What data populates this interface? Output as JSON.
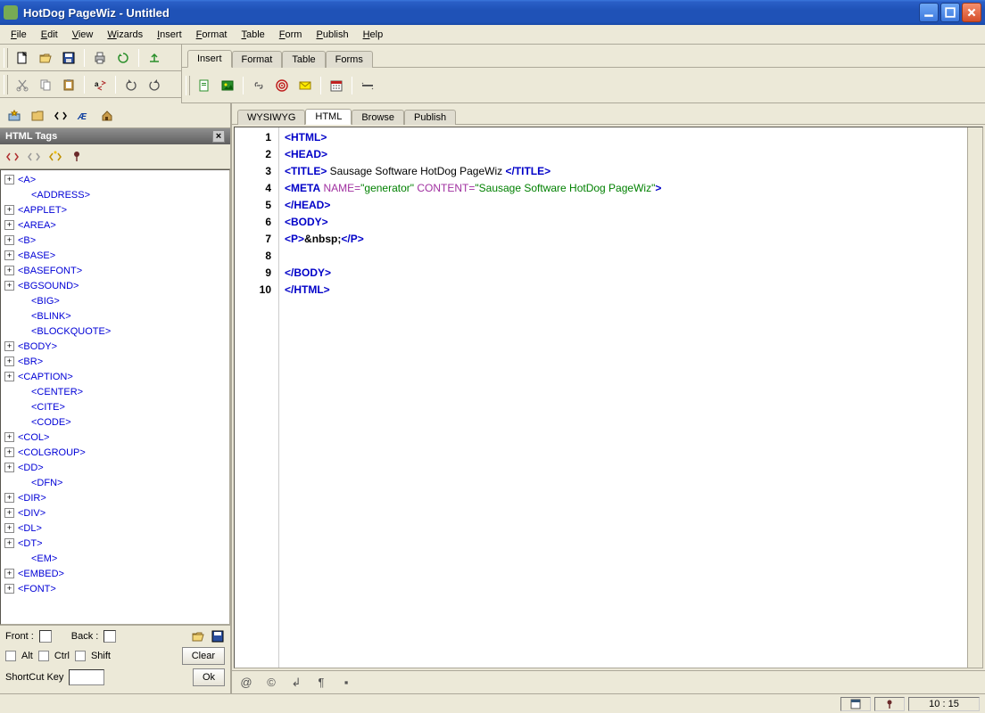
{
  "window": {
    "title": "HotDog PageWiz - Untitled"
  },
  "menu": [
    "File",
    "Edit",
    "View",
    "Wizards",
    "Insert",
    "Format",
    "Table",
    "Form",
    "Publish",
    "Help"
  ],
  "top_tabs": [
    "Insert",
    "Format",
    "Table",
    "Forms"
  ],
  "top_tabs_active": 0,
  "view_tabs": [
    "WYSIWYG",
    "HTML",
    "Browse",
    "Publish"
  ],
  "view_tabs_active": 1,
  "tags_panel": {
    "title": "HTML Tags",
    "items": [
      {
        "label": "<A>",
        "exp": true
      },
      {
        "label": "<ADDRESS>",
        "exp": false
      },
      {
        "label": "<APPLET>",
        "exp": true
      },
      {
        "label": "<AREA>",
        "exp": true
      },
      {
        "label": "<B>",
        "exp": true
      },
      {
        "label": "<BASE>",
        "exp": true
      },
      {
        "label": "<BASEFONT>",
        "exp": true
      },
      {
        "label": "<BGSOUND>",
        "exp": true
      },
      {
        "label": "<BIG>",
        "exp": false
      },
      {
        "label": "<BLINK>",
        "exp": false
      },
      {
        "label": "<BLOCKQUOTE>",
        "exp": false
      },
      {
        "label": "<BODY>",
        "exp": true
      },
      {
        "label": "<BR>",
        "exp": true
      },
      {
        "label": "<CAPTION>",
        "exp": true
      },
      {
        "label": "<CENTER>",
        "exp": false
      },
      {
        "label": "<CITE>",
        "exp": false
      },
      {
        "label": "<CODE>",
        "exp": false
      },
      {
        "label": "<COL>",
        "exp": true
      },
      {
        "label": "<COLGROUP>",
        "exp": true
      },
      {
        "label": "<DD>",
        "exp": true
      },
      {
        "label": "<DFN>",
        "exp": false
      },
      {
        "label": "<DIR>",
        "exp": true
      },
      {
        "label": "<DIV>",
        "exp": true
      },
      {
        "label": "<DL>",
        "exp": true
      },
      {
        "label": "<DT>",
        "exp": true
      },
      {
        "label": "<EM>",
        "exp": false
      },
      {
        "label": "<EMBED>",
        "exp": true
      },
      {
        "label": "<FONT>",
        "exp": true
      }
    ]
  },
  "bottom_left": {
    "front_label": "Front :",
    "back_label": "Back :",
    "alt": "Alt",
    "ctrl": "Ctrl",
    "shift": "Shift",
    "clear": "Clear",
    "ok": "Ok",
    "shortcut": "ShortCut Key"
  },
  "editor_lines": [
    {
      "n": 1,
      "seg": [
        {
          "t": "<HTML>",
          "c": "tag-blue"
        }
      ]
    },
    {
      "n": 2,
      "seg": [
        {
          "t": "<HEAD>",
          "c": "tag-blue"
        }
      ]
    },
    {
      "n": 3,
      "seg": [
        {
          "t": "<TITLE>",
          "c": "tag-blue"
        },
        {
          "t": " Sausage Software HotDog PageWiz ",
          "c": "tag-text"
        },
        {
          "t": "</TITLE>",
          "c": "tag-blue"
        }
      ]
    },
    {
      "n": 4,
      "seg": [
        {
          "t": "<META",
          "c": "tag-blue"
        },
        {
          "t": " NAME=",
          "c": "attr-purple"
        },
        {
          "t": "\"generator\"",
          "c": "attr-green"
        },
        {
          "t": " CONTENT=",
          "c": "attr-purple"
        },
        {
          "t": "\"Sausage Software HotDog PageWiz\"",
          "c": "attr-green"
        },
        {
          "t": ">",
          "c": "tag-blue"
        }
      ]
    },
    {
      "n": 5,
      "seg": [
        {
          "t": "</HEAD>",
          "c": "tag-blue"
        }
      ]
    },
    {
      "n": 6,
      "seg": [
        {
          "t": "<BODY>",
          "c": "tag-blue"
        }
      ]
    },
    {
      "n": 7,
      "seg": [
        {
          "t": "<P>",
          "c": "tag-blue"
        },
        {
          "t": "&nbsp;",
          "c": "ent"
        },
        {
          "t": "</P>",
          "c": "tag-blue"
        }
      ]
    },
    {
      "n": 8,
      "seg": []
    },
    {
      "n": 9,
      "seg": [
        {
          "t": "</BODY>",
          "c": "tag-blue"
        }
      ]
    },
    {
      "n": 10,
      "seg": [
        {
          "t": "</HTML>",
          "c": "tag-blue"
        }
      ]
    }
  ],
  "status_time": "10 : 15"
}
